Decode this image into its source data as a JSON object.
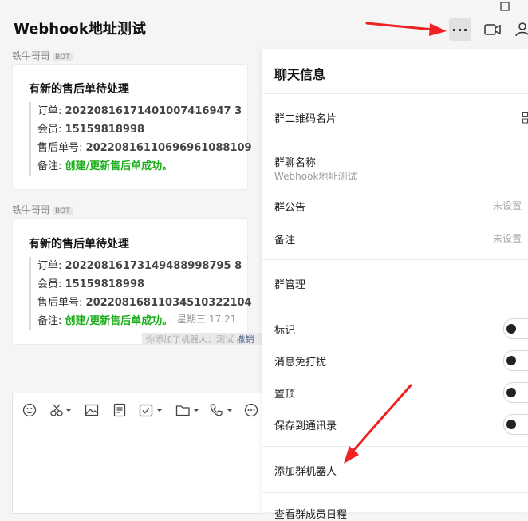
{
  "window": {
    "title": "Webhook地址测试",
    "more_label": "···"
  },
  "messages": [
    {
      "sender": "铁牛哥哥",
      "badge": "BOT",
      "title": "有新的售后单待处理",
      "order_label": "订单:",
      "order": "20220816171401007416947 3",
      "member_label": "会员:",
      "member": "15159818998",
      "after_sale_label": "售后单号:",
      "after_sale": "20220816110696961088109",
      "note_label": "备注:",
      "note": "创建/更新售后单成功。"
    },
    {
      "sender": "铁牛哥哥",
      "badge": "BOT",
      "title": "有新的售后单待处理",
      "order_label": "订单:",
      "order": "20220816173149488998795 8",
      "member_label": "会员:",
      "member": "15159818998",
      "after_sale_label": "售后单号:",
      "after_sale": "20220816811034510322104",
      "note_label": "备注:",
      "note": "创建/更新售后单成功。"
    }
  ],
  "timestamp": "星期三 17:21",
  "system_message": {
    "text": "你添加了机器人：测试",
    "link": "撤销"
  },
  "panel": {
    "title": "聊天信息",
    "qr_label": "群二维码名片",
    "group_name_label": "群聊名称",
    "group_name_value": "Webhook地址测试",
    "announcement_label": "群公告",
    "announcement_value": "未设置",
    "remark_label": "备注",
    "remark_value": "未设置",
    "manage_label": "群管理",
    "mark_label": "标记",
    "mute_label": "消息免打扰",
    "pin_label": "置顶",
    "save_contacts_label": "保存到通讯录",
    "add_robot_label": "添加群机器人",
    "more_label": "查看群成员日程"
  }
}
